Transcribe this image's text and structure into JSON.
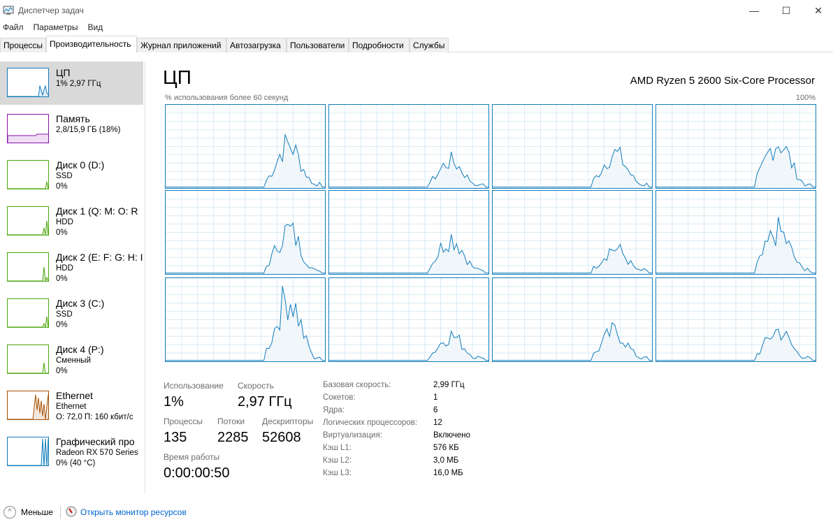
{
  "window": {
    "title": "Диспетчер задач",
    "minimize": "—",
    "maximize": "☐",
    "close": "✕"
  },
  "menu": [
    "Файл",
    "Параметры",
    "Вид"
  ],
  "tabs": [
    "Процессы",
    "Производительность",
    "Журнал приложений",
    "Автозагрузка",
    "Пользователи",
    "Подробности",
    "Службы"
  ],
  "sidebar": [
    {
      "name": "ЦП",
      "l2": "1% 2,97 ГГц",
      "l3": "",
      "color": "#117dbb"
    },
    {
      "name": "Память",
      "l2": "2,8/15,9 ГБ (18%)",
      "l3": "",
      "color": "#8b12ae"
    },
    {
      "name": "Диск 0 (D:)",
      "l2": "SSD",
      "l3": "0%",
      "color": "#4da60c"
    },
    {
      "name": "Диск 1 (Q: M: O: R",
      "l2": "HDD",
      "l3": "0%",
      "color": "#4da60c"
    },
    {
      "name": "Диск 2 (E: F: G: H: I",
      "l2": "HDD",
      "l3": "0%",
      "color": "#4da60c"
    },
    {
      "name": "Диск 3 (C:)",
      "l2": "SSD",
      "l3": "0%",
      "color": "#4da60c"
    },
    {
      "name": "Диск 4 (P:)",
      "l2": "Сменный",
      "l3": "0%",
      "color": "#4da60c"
    },
    {
      "name": "Ethernet",
      "l2": "Ethernet",
      "l3": "О: 72,0 П: 160 кбит/с",
      "color": "#a74f01"
    },
    {
      "name": "Графический про",
      "l2": "Radeon RX 570 Series",
      "l3": "0%  (40 °C)",
      "color": "#117dbb"
    }
  ],
  "main": {
    "title": "ЦП",
    "cpu_model": "AMD Ryzen 5 2600 Six-Core Processor",
    "graph_label": "% использования более 60 секунд",
    "graph_max": "100%",
    "stats": {
      "usage_label": "Использование",
      "usage": "1%",
      "speed_label": "Скорость",
      "speed": "2,97 ГГц",
      "proc_label": "Процессы",
      "proc": "135",
      "threads_label": "Потоки",
      "threads": "2285",
      "handles_label": "Дескрипторы",
      "handles": "52608",
      "uptime_label": "Время работы",
      "uptime": "0:00:00:50"
    },
    "details": [
      [
        "Базовая скорость:",
        "2,99 ГГц"
      ],
      [
        "Сокетов:",
        "1"
      ],
      [
        "Ядра:",
        "6"
      ],
      [
        "Логических процессоров:",
        "12"
      ],
      [
        "Виртуализация:",
        "Включено"
      ],
      [
        "Кэш L1:",
        "576 КБ"
      ],
      [
        "Кэш L2:",
        "3,0 МБ"
      ],
      [
        "Кэш L3:",
        "16,0 МБ"
      ]
    ]
  },
  "footer": {
    "less": "Меньше",
    "monitor": "Открыть монитор ресурсов"
  }
}
